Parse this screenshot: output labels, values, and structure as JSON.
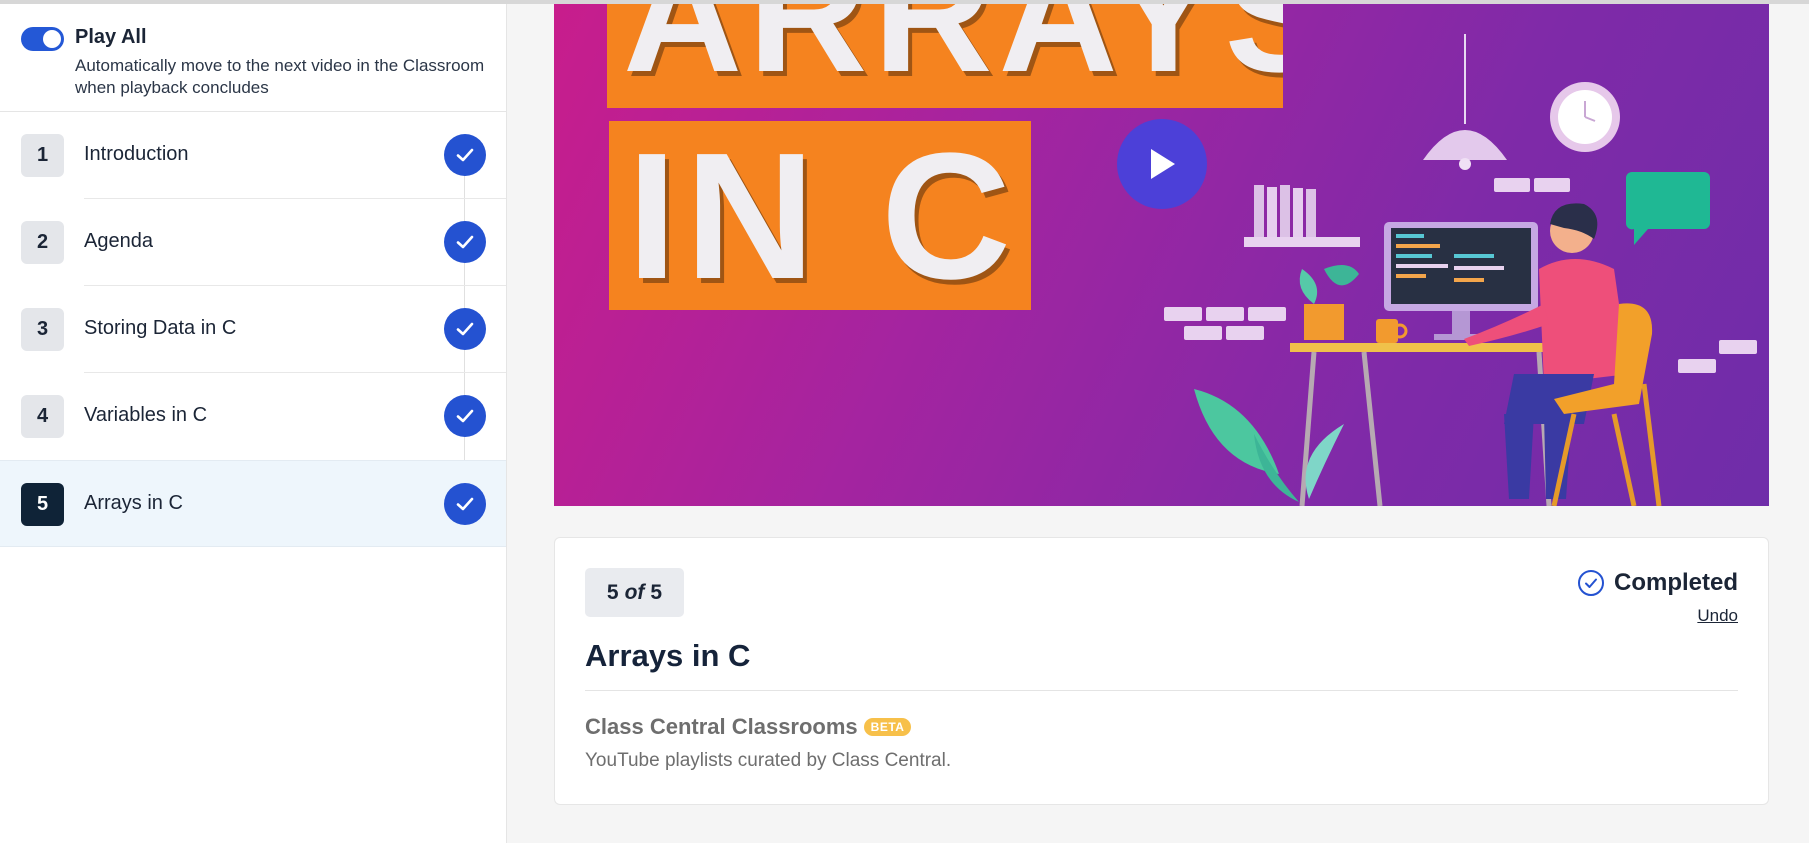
{
  "play_all": {
    "title": "Play All",
    "description": "Automatically move to the next video in the Classroom when playback concludes",
    "enabled": true
  },
  "playlist": {
    "items": [
      {
        "number": "1",
        "label": "Introduction",
        "completed": true
      },
      {
        "number": "2",
        "label": "Agenda",
        "completed": true
      },
      {
        "number": "3",
        "label": "Storing Data in C",
        "completed": true
      },
      {
        "number": "4",
        "label": "Variables in C",
        "completed": true
      },
      {
        "number": "5",
        "label": "Arrays in C",
        "completed": true,
        "active": true
      }
    ]
  },
  "video": {
    "thumbnail_text_line1": "ARRAYS",
    "thumbnail_text_line2": "IN C",
    "play_icon": "play-icon"
  },
  "info": {
    "position_current": "5",
    "position_of": "of",
    "position_total": "5",
    "status_label": "Completed",
    "undo_label": "Undo",
    "title": "Arrays in C",
    "source_name": "Class Central Classrooms",
    "badge": "BETA",
    "source_description": "YouTube playlists curated by Class Central."
  },
  "colors": {
    "accent": "#2452d1",
    "active_number_bg": "#0f2337",
    "active_row_bg": "#eef6fc",
    "thumbnail_orange": "#f5831f",
    "thumbnail_purple": "#7f2aa8",
    "beta_badge": "#f7c04a"
  }
}
